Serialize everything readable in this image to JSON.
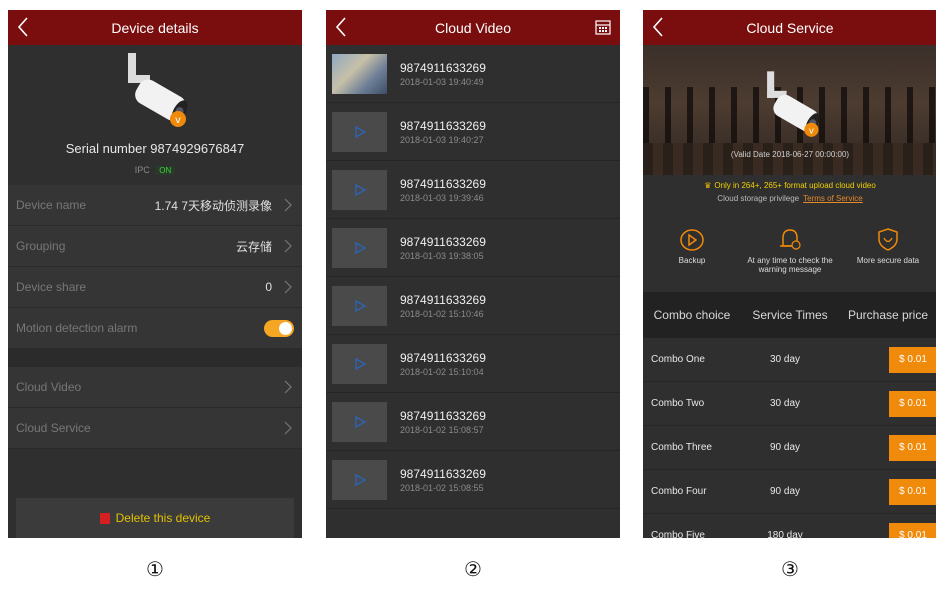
{
  "screen1": {
    "title": "Device details",
    "serial": "Serial number 9874929676847",
    "ipc_label": "IPC",
    "ipc_status": "ON",
    "rows": [
      {
        "label": "Device name",
        "value": "1.74 7天移动侦测录像"
      },
      {
        "label": "Grouping",
        "value": "云存储"
      },
      {
        "label": "Device share",
        "value": "0"
      }
    ],
    "motion_label": "Motion detection alarm",
    "motion_on": true,
    "cloud_video": "Cloud Video",
    "cloud_service": "Cloud Service",
    "delete": "Delete this device"
  },
  "screen2": {
    "title": "Cloud Video",
    "videos": [
      {
        "id": "9874911633269",
        "date": "2018-01-03 19:40:49"
      },
      {
        "id": "9874911633269",
        "date": "2018-01-03 19:40:27"
      },
      {
        "id": "9874911633269",
        "date": "2018-01-03 19:39:46"
      },
      {
        "id": "9874911633269",
        "date": "2018-01-03 19:38:05"
      },
      {
        "id": "9874911633269",
        "date": "2018-01-02 15:10:46"
      },
      {
        "id": "9874911633269",
        "date": "2018-01-02 15:10:04"
      },
      {
        "id": "9874911633269",
        "date": "2018-01-02 15:08:57"
      },
      {
        "id": "9874911633269",
        "date": "2018-01-02 15:08:55"
      }
    ]
  },
  "screen3": {
    "title": "Cloud Service",
    "valid_date": "(Valid Date 2018-06-27 00:00:00)",
    "format_note": "Only in 264+, 265+ format upload cloud video",
    "privilege": "Cloud storage privilege",
    "terms": "Terms of Service",
    "features": [
      "Backup",
      "At any time to check the warning message",
      "More secure data"
    ],
    "table_headers": [
      "Combo choice",
      "Service Times",
      "Purchase price"
    ],
    "combos": [
      {
        "name": "Combo One",
        "time": "30 day",
        "price": "$ 0.01"
      },
      {
        "name": "Combo Two",
        "time": "30 day",
        "price": "$ 0.01"
      },
      {
        "name": "Combo Three",
        "time": "90 day",
        "price": "$ 0.01"
      },
      {
        "name": "Combo Four",
        "time": "90 day",
        "price": "$ 0.01"
      },
      {
        "name": "Combo Five",
        "time": "180 day",
        "price": "$ 0.01"
      }
    ]
  },
  "captions": [
    "①",
    "②",
    "③"
  ],
  "colors": {
    "header": "#7a0e0e",
    "accent": "#f08a0a",
    "toggle": "#f5a623"
  }
}
